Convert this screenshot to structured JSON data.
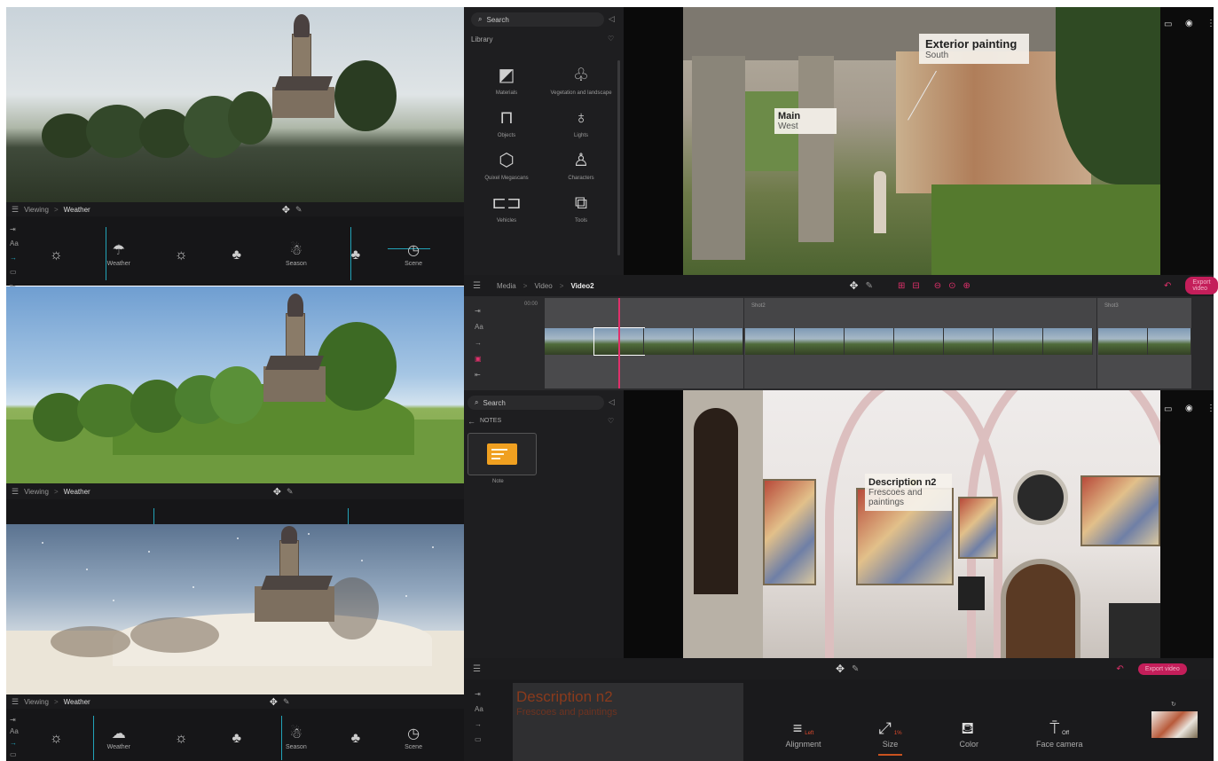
{
  "left_panels": {
    "view_bar_label": "Viewing",
    "view_bar_value": "Weather",
    "strip_top": {
      "items": [
        {
          "icon": "sun-icon",
          "label": ""
        },
        {
          "icon": "cloud-rain-icon",
          "label": "Weather"
        },
        {
          "icon": "sun-icon",
          "label": ""
        },
        {
          "icon": "tree-icon",
          "label": ""
        },
        {
          "icon": "snowman-icon",
          "label": "Season"
        },
        {
          "icon": "tree-icon",
          "label": ""
        },
        {
          "icon": "clock-icon",
          "label": "Scene"
        }
      ]
    },
    "strip_bottom": {
      "items": [
        {
          "icon": "sun-icon",
          "label": ""
        },
        {
          "icon": "cloud-icon",
          "label": "Weather"
        },
        {
          "icon": "sun-icon",
          "label": ""
        },
        {
          "icon": "tree-icon",
          "label": ""
        },
        {
          "icon": "snowman-icon",
          "label": "Season"
        },
        {
          "icon": "tree-icon",
          "label": ""
        },
        {
          "icon": "clock-icon",
          "label": "Scene"
        }
      ]
    }
  },
  "library": {
    "search_placeholder": "Search",
    "title": "Library",
    "items": [
      {
        "label": "Materials",
        "icon": "fan-icon"
      },
      {
        "label": "Vegetation and landscape",
        "icon": "tree-icon"
      },
      {
        "label": "Objects",
        "icon": "sofa-icon"
      },
      {
        "label": "Lights",
        "icon": "bulb-icon"
      },
      {
        "label": "Quixel Megascans",
        "icon": "quixel-icon"
      },
      {
        "label": "Characters",
        "icon": "person-icon"
      },
      {
        "label": "Vehicles",
        "icon": "car-icon"
      },
      {
        "label": "Tools",
        "icon": "cubes-icon"
      }
    ]
  },
  "timeline": {
    "breadcrumb": [
      "Media",
      "Video",
      "Video2"
    ],
    "export_label": "Export video",
    "clip_labels": [
      "00:00",
      "Shot2",
      "Shot3"
    ]
  },
  "notes": {
    "search_placeholder": "Search",
    "section_title": "NOTES",
    "note_label": "Note"
  },
  "callouts": {
    "exterior_title": "Exterior painting",
    "exterior_sub": "South",
    "main_title": "Main",
    "main_sub": "West",
    "interior_title": "Description n2",
    "interior_sub": "Frescoes and paintings"
  },
  "editor": {
    "title_value": "Description n2",
    "subtitle_value": "Frescoes and paintings",
    "export_label": "Export video",
    "props": [
      {
        "label": "Alignment",
        "value": "Left",
        "icon": "align-icon"
      },
      {
        "label": "Size",
        "value": "1%",
        "icon": "resize-icon"
      },
      {
        "label": "Color",
        "value": "",
        "icon": "paint-bucket-icon"
      },
      {
        "label": "Face camera",
        "value": "Off",
        "icon": "camera-face-icon"
      }
    ]
  },
  "colors": {
    "accent": "#c41e5a",
    "cyan": "#22a3b8",
    "text_orange": "#c9521f"
  }
}
